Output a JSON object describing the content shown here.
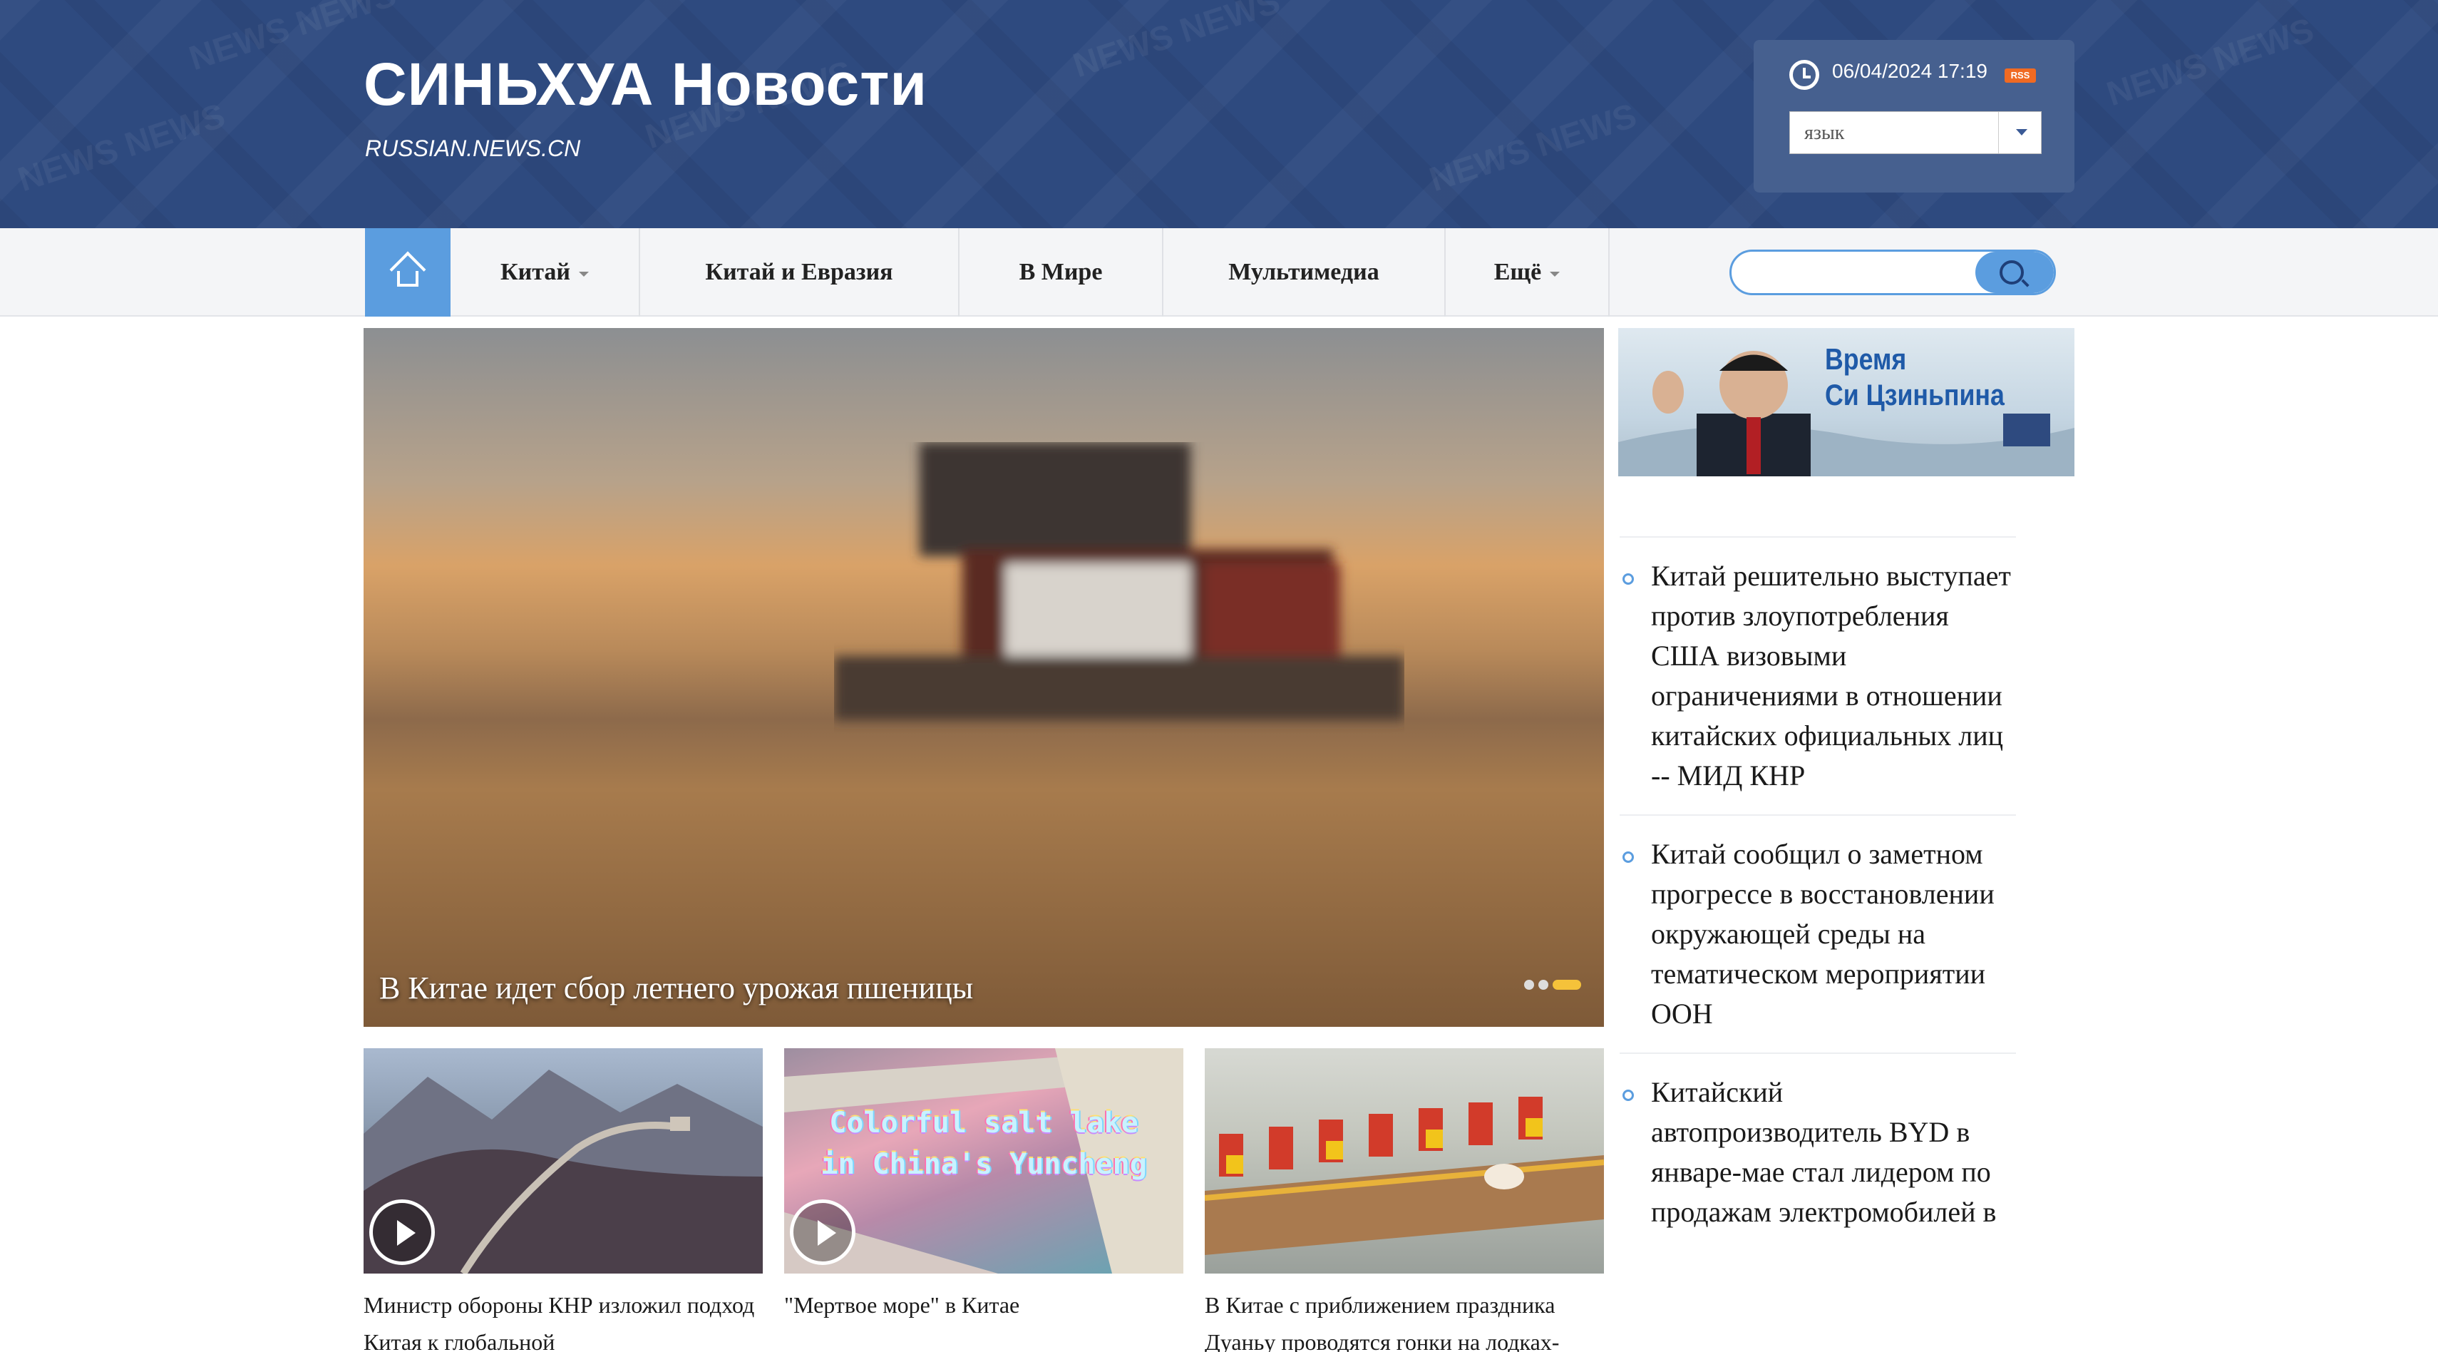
{
  "header": {
    "title": "СИНЬХУА Новости",
    "subtitle": "RUSSIAN.NEWS.CN",
    "datetime": "06/04/2024 17:19",
    "rss_label": "RSS",
    "language_select": {
      "value": "язык"
    }
  },
  "nav": {
    "items": [
      {
        "label": "Китай",
        "has_dropdown": true
      },
      {
        "label": "Китай и Евразия",
        "has_dropdown": false
      },
      {
        "label": "В Мире",
        "has_dropdown": false
      },
      {
        "label": "Мультимедиа",
        "has_dropdown": false
      },
      {
        "label": "Ещё",
        "has_dropdown": true
      }
    ],
    "search": {
      "value": "",
      "placeholder": ""
    }
  },
  "hero": {
    "caption": "В Китае идет сбор летнего урожая пшеницы",
    "slides_total": 3,
    "active_slide": 3
  },
  "promo": {
    "line1": "Время",
    "line2": "Си Цзиньпина"
  },
  "news": [
    {
      "text": "Китай решительно выступает против злоупотребления США визовыми ограничениями в отношении китайских официальных лиц -- МИД КНР"
    },
    {
      "text": "Китай сообщил о заметном прогрессе в восстановлении окружающей среды на тематическом мероприятии ООН"
    },
    {
      "text": "Китайский автопроизводитель BYD в январе-мае стал лидером по продажам электромобилей в"
    }
  ],
  "thumbs": [
    {
      "caption": "Министр обороны КНР изложил подход Китая к глобальной",
      "video": true,
      "overlay": ""
    },
    {
      "caption": "\"Мертвое море\" в Китае",
      "video": true,
      "overlay_line1": "Colorful salt lake",
      "overlay_line2": "in China's Yuncheng"
    },
    {
      "caption": "В Китае с приближением праздника Дуаньу проводятся гонки на лодках-",
      "video": false,
      "overlay": ""
    }
  ],
  "colors": {
    "header_bg": "#2e4a7f",
    "accent": "#5b9ddf",
    "active_dot": "#f5c23a",
    "rss": "#f06a22"
  }
}
